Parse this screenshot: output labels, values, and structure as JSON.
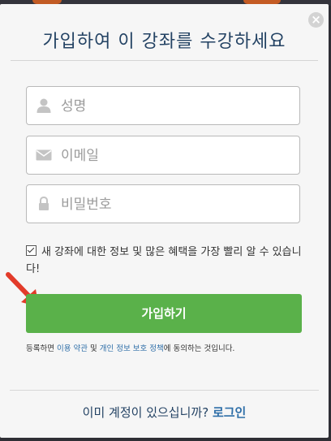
{
  "modal": {
    "title": "가입하여 이 강좌를 수강하세요",
    "close_icon": "close-icon"
  },
  "form": {
    "name_placeholder": "성명",
    "email_placeholder": "이메일",
    "password_placeholder": "비밀번호",
    "icons": [
      "user-icon",
      "envelope-icon",
      "lock-icon"
    ],
    "consent_text": "새 강좌에 대한 정보 및 많은 혜택을 가장 빨리 알 수 있습니다!",
    "consent_checked": true,
    "signup_label": "가입하기"
  },
  "terms": {
    "prefix": "등록하면 ",
    "tos_link": "이용 약관",
    "middle": " 및 ",
    "privacy_link": "개인 정보 보호 정책",
    "suffix": "에 동의하는 것입니다."
  },
  "footer": {
    "login_prompt": "이미 계정이 있으십니까? ",
    "login_link": "로그인"
  },
  "colors": {
    "primary_button": "#5ab14a",
    "title_text": "#244364",
    "link": "#2f6fa8",
    "annotation_arrow": "#e23b2a"
  }
}
